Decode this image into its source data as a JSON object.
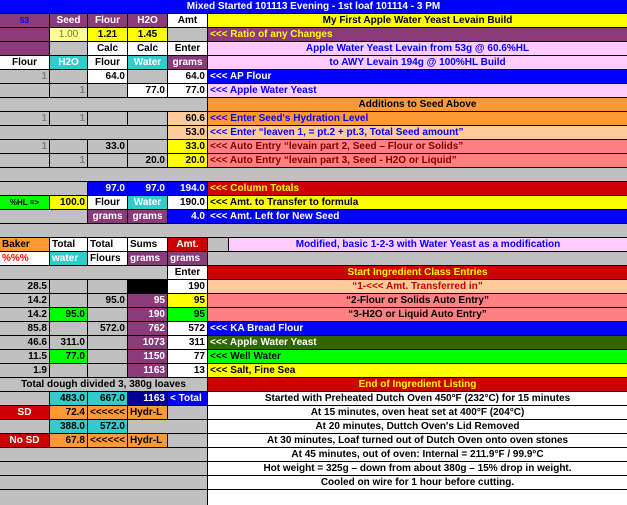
{
  "colors": {
    "black": "#000000",
    "blue": "#0000ff",
    "purple": "#8b3a7a",
    "gray": "#c0c0c0",
    "white": "#ffffff",
    "yellow": "#ffff00",
    "lightyellow": "#ffff99",
    "orange": "#ff9933",
    "peach": "#ffcc99",
    "salmon": "#ff8080",
    "red": "#cc0000",
    "green": "#00ff00",
    "teal": "#33cccc",
    "pink": "#ffccff",
    "darkgreen": "#336600",
    "darkblue": "#000099"
  },
  "title": "Mixed Started 101113 Evening - 1st loaf 101114 - 3 PM",
  "head": {
    "c53": "53",
    "seed": "Seed",
    "flour": "Flour",
    "h2o": "H2O",
    "amt": "Amt",
    "build_title": "My First Apple Water Yeast Levain Build"
  },
  "ratio": {
    "seed": "1.00",
    "flour": "1.21",
    "h2o": "1.45",
    "label": "<<<  Ratio of any Changes"
  },
  "calc": {
    "calc1": "Calc",
    "calc2": "Calc",
    "enter": "Enter",
    "desc": "Apple Water Yeast Levain from 53g @ 60.6%HL"
  },
  "units": {
    "flour": "Flour",
    "h2o": "H2O",
    "flour2": "Flour",
    "water": "Water",
    "grams": "grams",
    "desc": "to AWY Levain 194g @ 100%HL Build"
  },
  "rows": {
    "ap": {
      "seed": "1",
      "calc": "64.0",
      "amt": "64.0",
      "label": "<<< AP Flour"
    },
    "aw": {
      "h2o": "1",
      "calc": "77.0",
      "amt": "77.0",
      "label": "<<< Apple Water Yeast"
    },
    "additions": "Additions to Seed Above",
    "hyd": {
      "seed": "1",
      "h2o": "1",
      "amt": "60.6",
      "label": "<<< Enter Seed's Hydration Level"
    },
    "enter": {
      "amt": "53.0",
      "label": "<<< Enter  “leaven 1, = pt.2 + pt.3,      Total Seed amount”"
    },
    "auto1": {
      "seed": "1",
      "calc": "33.0",
      "amt": "33.0",
      "label": "<<<  Auto Entry      “levain part 2, Seed – Flour or Solids”"
    },
    "auto2": {
      "h2o": "1",
      "calc": "20.0",
      "amt": "20.0",
      "label": "<<<  Auto Entry      “levain part 3, Seed - H2O or Liquid”"
    },
    "totals": {
      "flour": "97.0",
      "water": "97.0",
      "amt": "194.0",
      "label": "<<<  Column Totals"
    },
    "hl": {
      "label": "%HL =>",
      "value": "100.0",
      "flour": "Flour",
      "water": "Water",
      "amt": "190.0",
      "desc": "<<< Amt. to Transfer to formula"
    },
    "left": {
      "g1": "grams",
      "g2": "grams",
      "amt": "4.0",
      "desc": "<<< Amt. Left for New Seed"
    }
  },
  "table2": {
    "h1": {
      "baker": "Baker",
      "total": "Total",
      "tflours": "Total",
      "sums": "Sums",
      "amt": "Amt.",
      "desc": "Modified, basic 1-2-3 with Water Yeast as a modification"
    },
    "h2": {
      "pct": "%%%",
      "water": "water",
      "flours": "Flours",
      "grams": "grams",
      "grams2": "grams"
    },
    "h3": {
      "enter": "Enter",
      "desc": "Start Ingredient Class Entries"
    },
    "rows": [
      {
        "pct": "28.5",
        "water": "",
        "flours": "",
        "sums": "",
        "amt": "190",
        "label": "“1-<<< Amt. Transferred in”"
      },
      {
        "pct": "14.2",
        "water": "",
        "flours": "95.0",
        "sums": "95",
        "amt": "95",
        "label": "“2-Flour or Solids Auto Entry”"
      },
      {
        "pct": "14.2",
        "water": "95.0",
        "flours": "",
        "sums": "190",
        "amt": "95",
        "label": "“3-H2O or Liquid Auto Entry”"
      },
      {
        "pct": "85.8",
        "water": "",
        "flours": "572.0",
        "sums": "762",
        "amt": "572",
        "label": "<<<  KA Bread Flour"
      },
      {
        "pct": "46.6",
        "water": "311.0",
        "flours": "",
        "sums": "1073",
        "amt": "311",
        "label": "<<< Apple Water Yeast"
      },
      {
        "pct": "11.5",
        "water": "77.0",
        "flours": "",
        "sums": "1150",
        "amt": "77",
        "label": "<<<  Well  Water"
      },
      {
        "pct": "1.9",
        "water": "",
        "flours": "",
        "sums": "1163",
        "amt": "13",
        "label": "<<< Salt, Fine Sea"
      }
    ],
    "dough": {
      "text": "Total dough divided 3, 380g loaves",
      "end": "End of Ingredient Listing"
    },
    "tot": {
      "water": "483.0",
      "flours": "667.0",
      "sums": "1163",
      "amt": "< Total",
      "note": "Started  with Preheated Dutch Oven 450°F (232°C) for 15 minutes"
    },
    "sd": {
      "label": "SD",
      "water": "72.4",
      "arrows": "<<<<<<",
      "hydr": "Hydr-L",
      "note": "At 15 minutes, oven heat set at  400°F (204°C)"
    },
    "blank": {
      "water": "388.0",
      "flours": "572.0",
      "note": "At 20 minutes, Duttch Oven's Lid Removed"
    },
    "nosd": {
      "label": "No SD",
      "water": "67.8",
      "arrows": "<<<<<<",
      "hydr": "Hydr-L",
      "note": "At 30 minutes, Loaf turned out of Dutch Oven onto oven stones"
    },
    "n5": "At 45 minutes, out of oven: Internal = 211.9°F / 99.9°C",
    "n6": "Hot weight = 325g – down from about 380g – 15% drop in weight.",
    "n7": "Cooled on wire for 1 hour before cutting."
  }
}
